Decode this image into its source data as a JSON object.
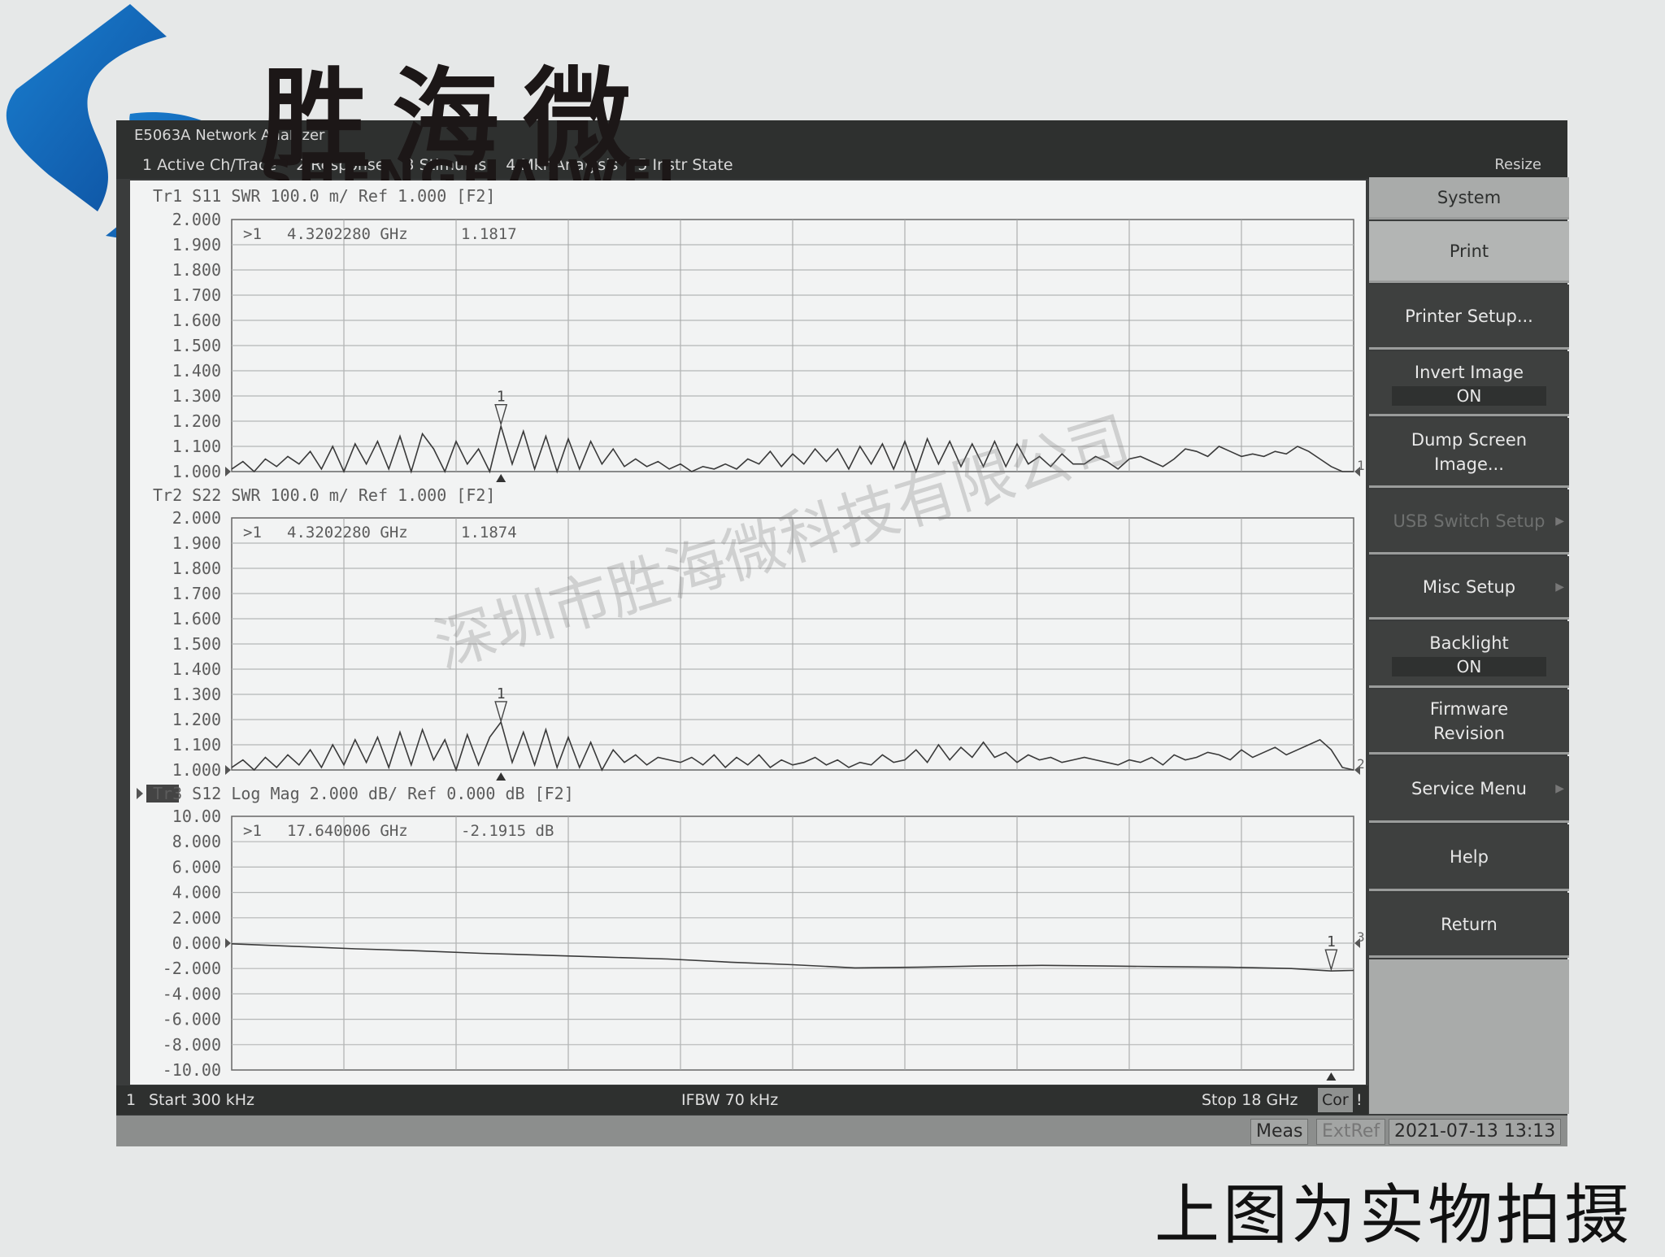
{
  "logo": {
    "brand_cn": "胜海微",
    "brand_en": "SHENGHAIWEI",
    "icon": "s-swirl-logo-icon"
  },
  "window": {
    "title": "E5063A Network Analyzer",
    "resize_label": "Resize",
    "menu": [
      "1 Active Ch/Trace",
      "2 Response",
      "3 Stimulus",
      "4 Mkr/Analysis",
      "5 Instr State"
    ]
  },
  "softkeys": {
    "items": [
      {
        "label": "System",
        "style": "light"
      },
      {
        "label": "Print",
        "style": "lighter"
      },
      {
        "label": "Printer Setup...",
        "style": "dark"
      },
      {
        "label": "Invert Image",
        "value": "ON",
        "style": "dark"
      },
      {
        "label": "Dump Screen Image...",
        "style": "dark"
      },
      {
        "label": "USB Switch Setup",
        "style": "disabled",
        "submenu": true
      },
      {
        "label": "Misc Setup",
        "style": "dark",
        "submenu": true
      },
      {
        "label": "Backlight",
        "value": "ON",
        "style": "dark"
      },
      {
        "label": "Firmware Revision",
        "style": "dark"
      },
      {
        "label": "Service Menu",
        "style": "dark",
        "submenu": true
      },
      {
        "label": "Help",
        "style": "dark"
      },
      {
        "label": "Return",
        "style": "dark"
      }
    ]
  },
  "status": {
    "channel": "1",
    "start": "Start 300 kHz",
    "ifbw": "IFBW 70 kHz",
    "stop": "Stop 18 GHz",
    "cor": "Cor",
    "warn": "!",
    "meas": "Meas",
    "extref": "ExtRef",
    "datetime": "2021-07-13 13:13"
  },
  "caption": "上图为实物拍摄",
  "watermark": "深圳市胜海微科技有限公司",
  "chart_data": [
    {
      "type": "line",
      "title": "Tr1 S11 SWR 100.0 m/ Ref 1.000 [F2]",
      "trace_id": "Tr1",
      "param": "S11",
      "format": "SWR",
      "ylim": [
        1.0,
        2.0
      ],
      "yticks": [
        "2.000",
        "1.900",
        "1.800",
        "1.700",
        "1.600",
        "1.500",
        "1.400",
        "1.300",
        "1.200",
        "1.100",
        "1.000"
      ],
      "xlim_ghz": [
        0.0003,
        18
      ],
      "grid": true,
      "marker": {
        "id": "1",
        "label": ">1",
        "freq": "4.3202280 GHz",
        "value": "1.1817",
        "x_ghz": 4.32,
        "y": 1.1817
      },
      "end_label": "1",
      "x_ghz": [
        0.0003,
        0.18,
        0.36,
        0.54,
        0.72,
        0.9,
        1.08,
        1.26,
        1.44,
        1.62,
        1.8,
        1.98,
        2.16,
        2.34,
        2.52,
        2.7,
        2.88,
        3.06,
        3.24,
        3.42,
        3.6,
        3.78,
        3.96,
        4.14,
        4.32,
        4.5,
        4.68,
        4.86,
        5.04,
        5.22,
        5.4,
        5.58,
        5.76,
        5.94,
        6.12,
        6.3,
        6.48,
        6.66,
        6.84,
        7.02,
        7.2,
        7.38,
        7.56,
        7.74,
        7.92,
        8.1,
        8.28,
        8.46,
        8.64,
        8.82,
        9.0,
        9.18,
        9.36,
        9.54,
        9.72,
        9.9,
        10.08,
        10.26,
        10.44,
        10.62,
        10.8,
        10.98,
        11.16,
        11.34,
        11.52,
        11.7,
        11.88,
        12.06,
        12.24,
        12.42,
        12.6,
        12.78,
        12.96,
        13.14,
        13.32,
        13.5,
        13.68,
        13.86,
        14.04,
        14.22,
        14.4,
        14.58,
        14.76,
        14.94,
        15.12,
        15.3,
        15.48,
        15.66,
        15.84,
        16.02,
        16.2,
        16.38,
        16.56,
        16.74,
        16.92,
        17.1,
        17.28,
        17.46,
        17.64,
        17.82,
        18.0
      ],
      "values": [
        1.01,
        1.04,
        1.0,
        1.05,
        1.02,
        1.06,
        1.03,
        1.08,
        1.01,
        1.1,
        1.0,
        1.11,
        1.03,
        1.12,
        1.01,
        1.14,
        1.0,
        1.15,
        1.09,
        1.0,
        1.12,
        1.03,
        1.09,
        1.0,
        1.18,
        1.03,
        1.16,
        1.01,
        1.14,
        1.0,
        1.13,
        1.01,
        1.12,
        1.03,
        1.09,
        1.02,
        1.05,
        1.02,
        1.04,
        1.01,
        1.03,
        1.0,
        1.02,
        1.01,
        1.03,
        1.01,
        1.05,
        1.03,
        1.08,
        1.02,
        1.07,
        1.03,
        1.09,
        1.04,
        1.09,
        1.01,
        1.1,
        1.03,
        1.11,
        1.01,
        1.12,
        1.0,
        1.13,
        1.03,
        1.12,
        1.02,
        1.11,
        1.02,
        1.12,
        1.02,
        1.11,
        1.03,
        1.06,
        1.02,
        1.07,
        1.03,
        1.03,
        1.06,
        1.04,
        1.01,
        1.05,
        1.06,
        1.04,
        1.02,
        1.05,
        1.09,
        1.08,
        1.06,
        1.1,
        1.08,
        1.06,
        1.07,
        1.06,
        1.08,
        1.07,
        1.1,
        1.08,
        1.05,
        1.02,
        1.0,
        1.0
      ]
    },
    {
      "type": "line",
      "title": "Tr2 S22 SWR 100.0 m/ Ref 1.000 [F2]",
      "trace_id": "Tr2",
      "param": "S22",
      "format": "SWR",
      "ylim": [
        1.0,
        2.0
      ],
      "yticks": [
        "2.000",
        "1.900",
        "1.800",
        "1.700",
        "1.600",
        "1.500",
        "1.400",
        "1.300",
        "1.200",
        "1.100",
        "1.000"
      ],
      "xlim_ghz": [
        0.0003,
        18
      ],
      "grid": true,
      "marker": {
        "id": "1",
        "label": ">1",
        "freq": "4.3202280 GHz",
        "value": "1.1874",
        "x_ghz": 4.32,
        "y": 1.1874
      },
      "end_label": "2",
      "x_ghz": [
        0.0003,
        0.18,
        0.36,
        0.54,
        0.72,
        0.9,
        1.08,
        1.26,
        1.44,
        1.62,
        1.8,
        1.98,
        2.16,
        2.34,
        2.52,
        2.7,
        2.88,
        3.06,
        3.24,
        3.42,
        3.6,
        3.78,
        3.96,
        4.14,
        4.32,
        4.5,
        4.68,
        4.86,
        5.04,
        5.22,
        5.4,
        5.58,
        5.76,
        5.94,
        6.12,
        6.3,
        6.48,
        6.66,
        6.84,
        7.02,
        7.2,
        7.38,
        7.56,
        7.74,
        7.92,
        8.1,
        8.28,
        8.46,
        8.64,
        8.82,
        9.0,
        9.18,
        9.36,
        9.54,
        9.72,
        9.9,
        10.08,
        10.26,
        10.44,
        10.62,
        10.8,
        10.98,
        11.16,
        11.34,
        11.52,
        11.7,
        11.88,
        12.06,
        12.24,
        12.42,
        12.6,
        12.78,
        12.96,
        13.14,
        13.32,
        13.5,
        13.68,
        13.86,
        14.04,
        14.22,
        14.4,
        14.58,
        14.76,
        14.94,
        15.12,
        15.3,
        15.48,
        15.66,
        15.84,
        16.02,
        16.2,
        16.38,
        16.56,
        16.74,
        16.92,
        17.1,
        17.28,
        17.46,
        17.64,
        17.82,
        18.0
      ],
      "values": [
        1.01,
        1.04,
        1.0,
        1.05,
        1.01,
        1.06,
        1.02,
        1.08,
        1.01,
        1.1,
        1.02,
        1.12,
        1.03,
        1.13,
        1.01,
        1.15,
        1.02,
        1.16,
        1.04,
        1.12,
        1.0,
        1.14,
        1.02,
        1.13,
        1.19,
        1.03,
        1.15,
        1.02,
        1.16,
        1.01,
        1.13,
        1.01,
        1.11,
        1.0,
        1.08,
        1.03,
        1.06,
        1.02,
        1.05,
        1.04,
        1.03,
        1.05,
        1.02,
        1.06,
        1.01,
        1.05,
        1.02,
        1.06,
        1.01,
        1.04,
        1.02,
        1.03,
        1.05,
        1.02,
        1.04,
        1.01,
        1.03,
        1.02,
        1.06,
        1.03,
        1.04,
        1.08,
        1.03,
        1.1,
        1.04,
        1.09,
        1.05,
        1.11,
        1.05,
        1.07,
        1.03,
        1.06,
        1.04,
        1.05,
        1.03,
        1.04,
        1.05,
        1.04,
        1.03,
        1.02,
        1.04,
        1.03,
        1.05,
        1.02,
        1.06,
        1.04,
        1.05,
        1.07,
        1.06,
        1.04,
        1.08,
        1.05,
        1.07,
        1.09,
        1.06,
        1.08,
        1.1,
        1.12,
        1.08,
        1.01,
        1.0
      ]
    },
    {
      "type": "line",
      "title": "Tr3 S12 Log Mag 2.000 dB/ Ref 0.000 dB [F2]",
      "trace_id": "Tr3",
      "active": true,
      "param": "S12",
      "format": "Log Mag",
      "ylabel_unit": "dB",
      "ylim": [
        -10,
        10
      ],
      "yticks": [
        "10.00",
        "8.000",
        "6.000",
        "4.000",
        "2.000",
        "0.000",
        "-2.000",
        "-4.000",
        "-6.000",
        "-8.000",
        "-10.00"
      ],
      "xlim_ghz": [
        0.0003,
        18
      ],
      "grid": true,
      "marker": {
        "id": "1",
        "label": ">1",
        "freq": "17.640006 GHz",
        "value": "-2.1915 dB",
        "x_ghz": 17.64,
        "y": -2.1915
      },
      "end_label": "3",
      "x_ghz": [
        0.0003,
        1,
        2,
        3,
        4,
        5,
        6,
        7,
        8,
        9,
        10,
        11,
        12,
        13,
        14,
        15,
        16,
        17,
        17.64,
        18
      ],
      "values": [
        -0.05,
        -0.25,
        -0.45,
        -0.6,
        -0.8,
        -0.95,
        -1.1,
        -1.25,
        -1.5,
        -1.7,
        -1.95,
        -1.9,
        -1.8,
        -1.75,
        -1.8,
        -1.85,
        -1.9,
        -2.0,
        -2.19,
        -2.15
      ]
    }
  ]
}
